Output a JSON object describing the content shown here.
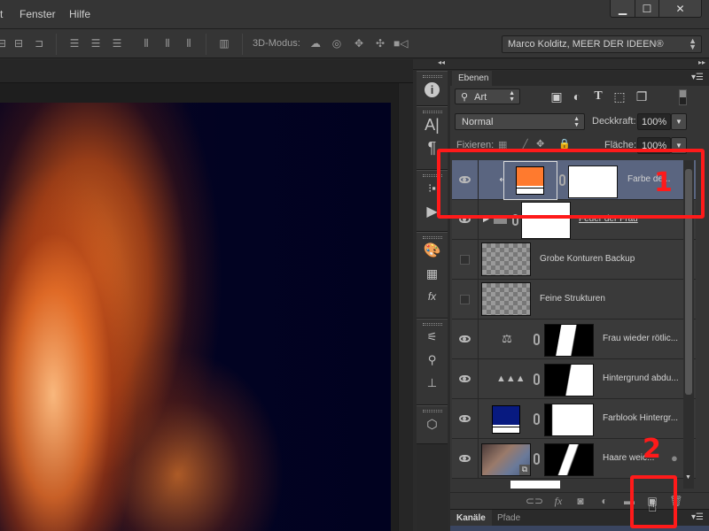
{
  "menubar": {
    "items": [
      "t",
      "Fenster",
      "Hilfe"
    ],
    "window_controls": {
      "minimize": "▁",
      "maximize": "☐",
      "close": "✕"
    }
  },
  "options_bar": {
    "align_icons": [
      "align-hcenter-icon",
      "align-right-icon",
      "distribute-top-icon",
      "distribute-vcenter-icon",
      "distribute-bottom-icon",
      "distribute-left-icon",
      "distribute-hcenter-icon",
      "distribute-right-icon",
      "auto-align-icon"
    ],
    "mode3d_label": "3D-Modus:",
    "mode3d_icons": [
      "orbit-icon",
      "roll-icon",
      "pan-icon",
      "slide-icon",
      "camera-icon"
    ],
    "preset": "Marco Kolditz, MEER DER IDEEN®"
  },
  "layers_panel": {
    "tab": "Ebenen",
    "filter": {
      "label": "Art",
      "icons": [
        "pixel-filter-icon",
        "adjustment-filter-icon",
        "type-filter-icon",
        "shape-filter-icon",
        "smartobject-filter-icon"
      ]
    },
    "blend_mode": "Normal",
    "opacity_label": "Deckkraft:",
    "opacity_value": "100%",
    "lock_label": "Fixieren:",
    "fill_label": "Fläche:",
    "fill_value": "100%",
    "layers": [
      {
        "name": "Farbe de...",
        "visible": true,
        "selected": true,
        "type": "color-fill",
        "thumb_color": "#ff7a2e",
        "clipped": true,
        "has_mask": true
      },
      {
        "name": "Feuer der Frau",
        "visible": true,
        "selected": false,
        "type": "group",
        "has_mask": true
      },
      {
        "name": "Grobe Konturen Backup",
        "visible": false,
        "selected": false,
        "type": "pixel"
      },
      {
        "name": "Feine Strukturen",
        "visible": false,
        "selected": false,
        "type": "pixel"
      },
      {
        "name": "Frau wieder rötlic...",
        "visible": true,
        "selected": false,
        "type": "color-balance",
        "has_mask": true
      },
      {
        "name": "Hintergrund abdu...",
        "visible": true,
        "selected": false,
        "type": "levels",
        "has_mask": true
      },
      {
        "name": "Farblook Hintergr...",
        "visible": true,
        "selected": false,
        "type": "color-fill",
        "thumb_color": "#081a80",
        "has_mask": true
      },
      {
        "name": "Haare weic...",
        "visible": true,
        "selected": false,
        "type": "smart-object",
        "has_mask": true
      }
    ],
    "bottom_icons": [
      "link-layers-icon",
      "fx-icon",
      "add-mask-icon",
      "adjustment-layer-icon",
      "new-group-icon",
      "new-layer-icon",
      "delete-icon"
    ]
  },
  "bottom_tabs": [
    "Kanäle",
    "Pfade"
  ],
  "annotations": [
    "1",
    "2"
  ],
  "strip_icons": [
    "info-icon",
    "character-icon",
    "paragraph-icon",
    "actions-icon",
    "play-icon",
    "swatches-icon",
    "grid-icon",
    "styles-icon",
    "brush-presets-icon",
    "brushes-icon",
    "clone-source-icon",
    "3d-icon"
  ]
}
